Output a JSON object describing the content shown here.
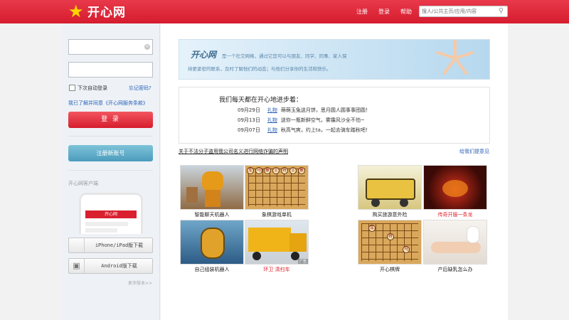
{
  "header": {
    "logo_text": "开心网",
    "nav": {
      "register": "注册",
      "login": "登录",
      "help": "帮助"
    },
    "search_placeholder": "搜人/公共主页/应用/内容"
  },
  "sidebar": {
    "remember_me": "下次自动登录",
    "forgot_password": "忘记密码?",
    "agreement": "我已了解并同意《开心网服务条款》",
    "login_button": "登 录",
    "register_button": "注册新账号",
    "client_label": "开心网客户端",
    "phone_screen_title": "开心网",
    "download_ios": "iPhone/iPad版下载",
    "download_android": "Android版下载",
    "more_versions": "更多版本>>"
  },
  "banner": {
    "title": "开心网",
    "line1": "是一个社交网络，通过它您可以与朋友、同学、同事、家人保",
    "line2": "持更紧密的联系，及时了解他们的动态；与他们分享你的生活和快乐。"
  },
  "news": {
    "title": "我们每天都在开心地进步着：",
    "items": [
      {
        "date": "09月29日",
        "tag": "礼物",
        "text": "萌萌玉兔送月饼，思月圆人圆事事团圆！"
      },
      {
        "date": "09月13日",
        "tag": "礼物",
        "text": "送你一瓶新鲜空气，雾霾风沙全不怕~"
      },
      {
        "date": "09月07日",
        "tag": "礼物",
        "text": "秋高气爽，约上ta，一起去骑车踏秋吧！"
      }
    ]
  },
  "notice": "关于不法分子盗用我公司名义进行网络诈骗的声明",
  "feedback": "给我们提意见",
  "apps": [
    {
      "caption": "智能聊天机器人"
    },
    {
      "caption": "象棋游戏单机"
    },
    {
      "caption": "购买旅游意外险"
    },
    {
      "caption": "传奇开服一条龙"
    },
    {
      "caption": "自己组装机器人"
    },
    {
      "caption": "环卫 清扫车"
    },
    {
      "caption": "开心棋牌"
    },
    {
      "caption": "产后缺乳怎么办"
    }
  ],
  "ad_tag": "广告",
  "chess_pieces": [
    "车",
    "马",
    "象",
    "士",
    "将",
    "士",
    "象",
    "马",
    "车"
  ],
  "colors": {
    "brand_red": "#d51c2e",
    "link_blue": "#2a62b8",
    "caption_red": "#e0202c"
  },
  "icons": [
    "star-logo-icon",
    "search-icon",
    "clear-icon",
    "apple-icon",
    "android-icon"
  ]
}
